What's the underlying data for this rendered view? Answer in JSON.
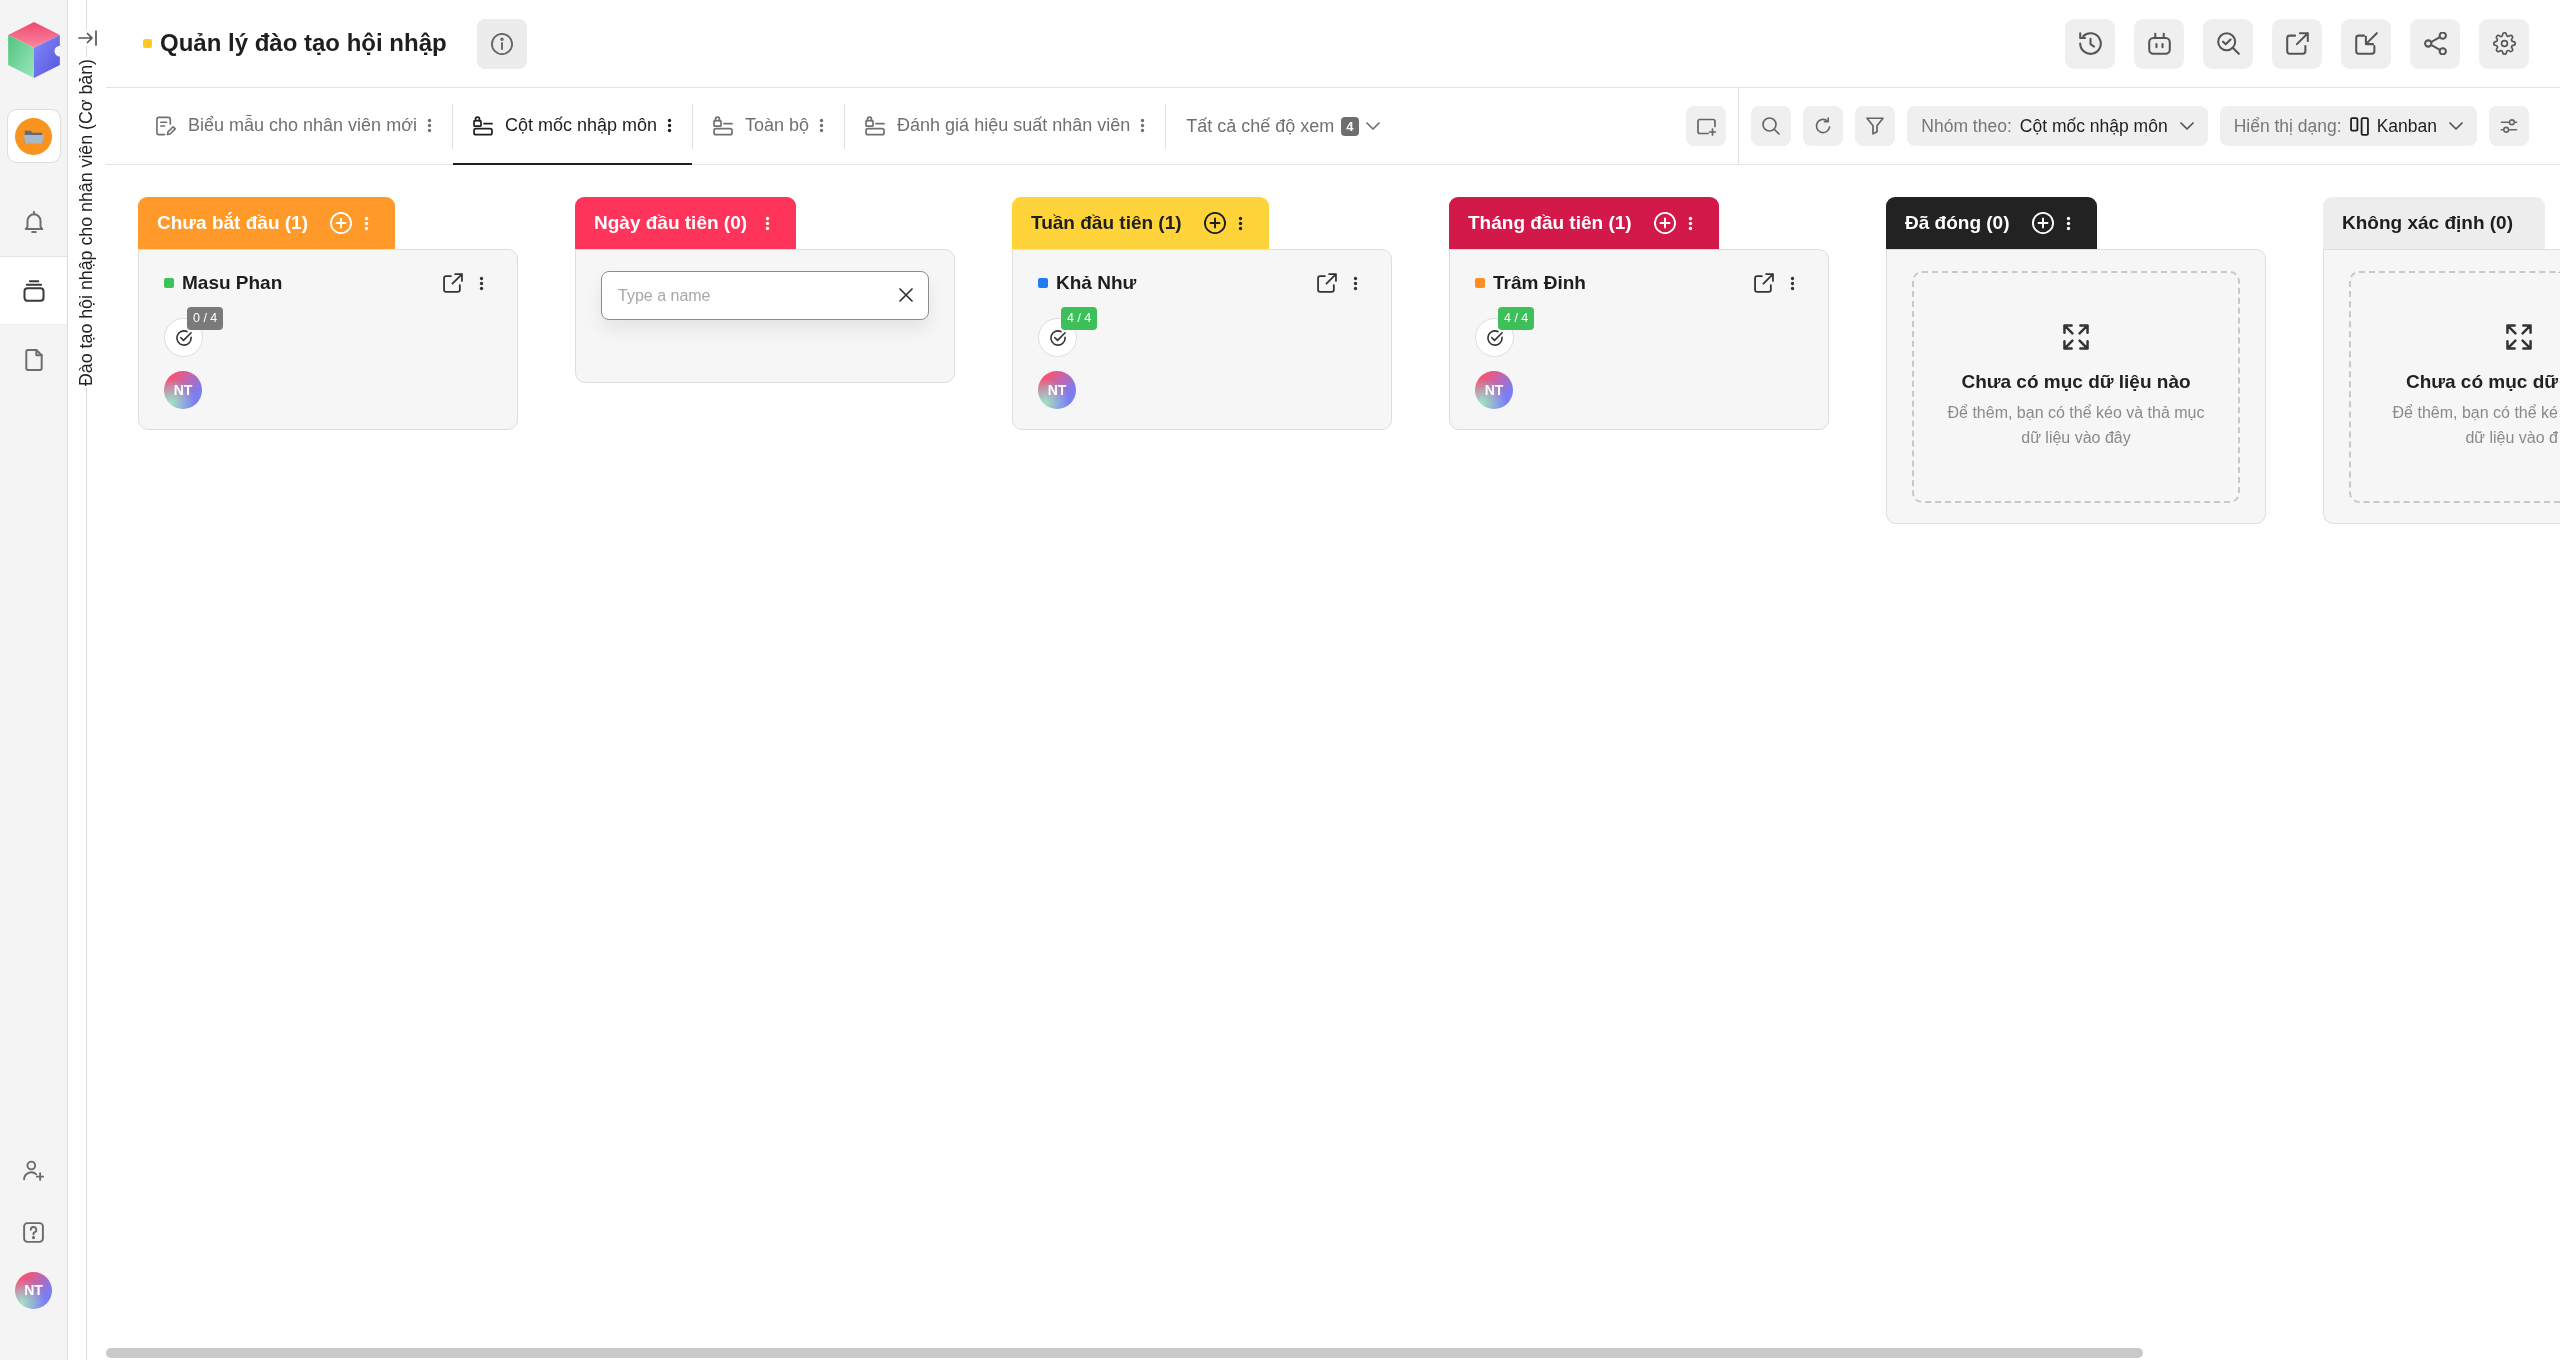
{
  "sidebar": {
    "nav": [
      {
        "selected": false
      },
      {
        "selected": true
      },
      {
        "selected": false
      }
    ],
    "user": {
      "initials": "NT"
    }
  },
  "rail": {
    "title": "Đào tạo hội nhập cho nhân viên (Cơ bản)"
  },
  "header": {
    "title": "Quản lý đào tạo hội nhập"
  },
  "tabs": [
    {
      "label": "Biểu mẫu cho nhân viên mới",
      "kind": "form",
      "selected": false
    },
    {
      "label": "Cột mốc nhập môn",
      "kind": "view",
      "selected": true
    },
    {
      "label": "Toàn bộ",
      "kind": "view",
      "selected": false
    },
    {
      "label": "Đánh giá hiệu suất nhân viên",
      "kind": "view",
      "selected": false
    }
  ],
  "views_menu": {
    "label": "Tất cả chế độ xem",
    "count": "4"
  },
  "toolbar": {
    "group_by": {
      "label": "Nhóm theo:",
      "value": "Cột mốc nhập môn"
    },
    "display": {
      "label": "Hiển thị dạng:",
      "value": "Kanban"
    }
  },
  "columns": [
    {
      "title": "Chưa bắt đầu (1)",
      "color": "#ff9a2a",
      "add_button": true,
      "cards": [
        {
          "name": "Masu Phan",
          "color": "#3cc45a",
          "progress": "0 / 4",
          "complete": false,
          "assignee": "NT"
        }
      ]
    },
    {
      "title": "Ngày đầu tiên (0)",
      "color": "#ff345a",
      "add_button": false,
      "new_item": {
        "placeholder": "Type a name"
      }
    },
    {
      "title": "Tuần đầu tiên (1)",
      "color": "#ffd43b",
      "add_button": true,
      "cards": [
        {
          "name": "Khả Như",
          "color": "#1f7cf2",
          "progress": "4 / 4",
          "complete": true,
          "assignee": "NT"
        }
      ]
    },
    {
      "title": "Tháng đầu tiên (1)",
      "color": "#d3184a",
      "add_button": true,
      "cards": [
        {
          "name": "Trâm Đinh",
          "color": "#ff8c1f",
          "progress": "4 / 4",
          "complete": true,
          "assignee": "NT"
        }
      ]
    },
    {
      "title": "Đã đóng (0)",
      "color": "#222222",
      "add_button": true,
      "empty_state": {
        "title": "Chưa có mục dữ liệu nào",
        "description": [
          "Để thêm, bạn có thể kéo và thả mục",
          "dữ liệu vào đây"
        ]
      }
    },
    {
      "title": "Không xác định (0)",
      "color": "#ededed",
      "add_button": false,
      "empty_state": {
        "title": "Chưa có mục dữ",
        "description": [
          "Để thêm, bạn có thể ké",
          "dữ liệu vào đ"
        ]
      }
    }
  ]
}
